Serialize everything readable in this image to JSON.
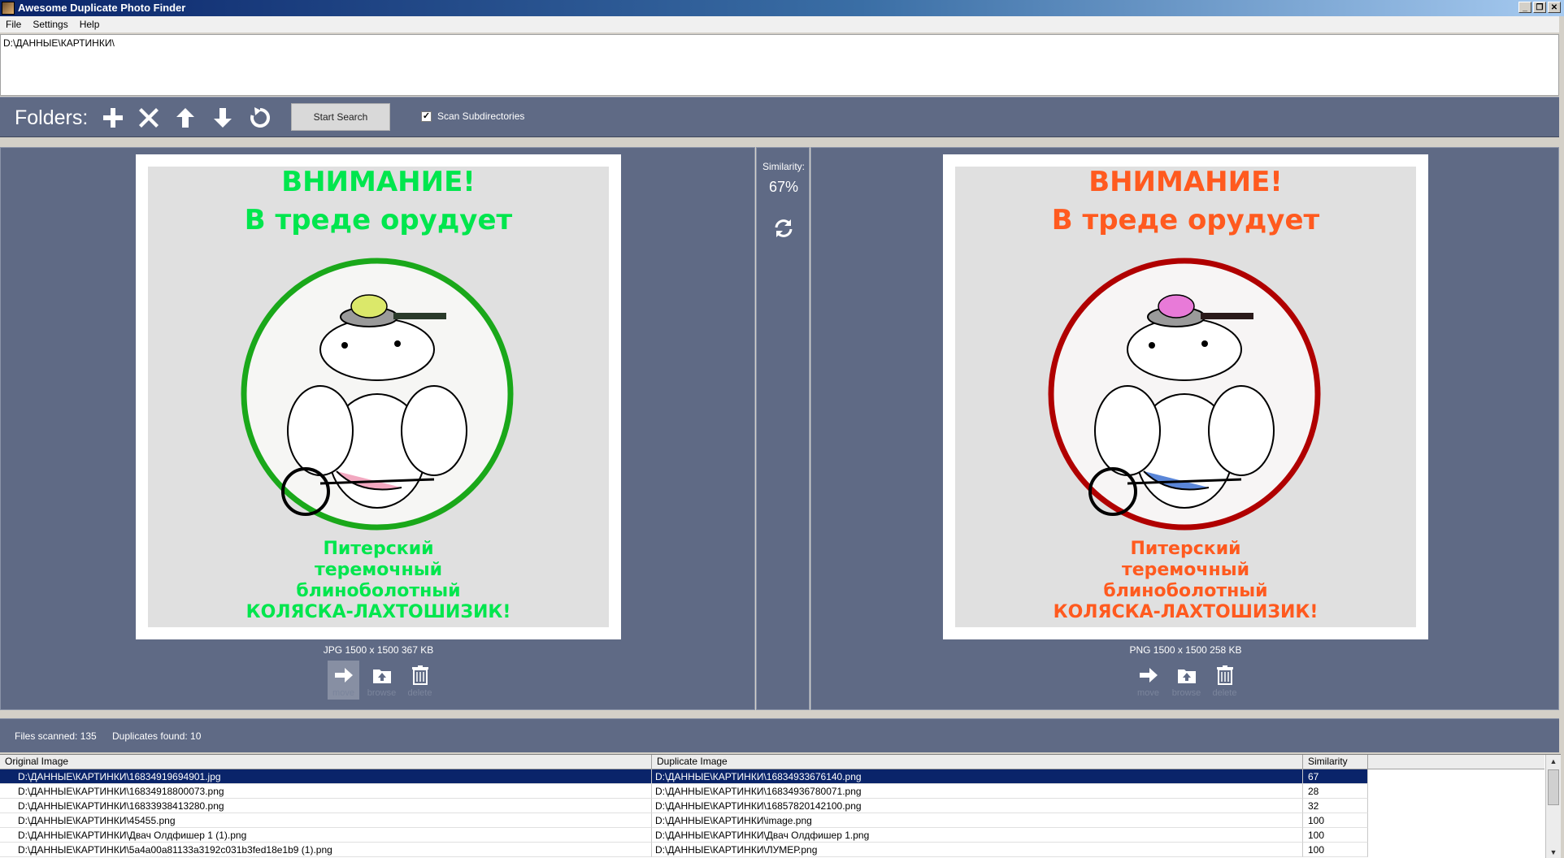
{
  "window": {
    "title": "Awesome Duplicate Photo Finder",
    "buttons": [
      "_",
      "❐",
      "✕"
    ]
  },
  "menu": [
    {
      "label": "File"
    },
    {
      "label": "Settings"
    },
    {
      "label": "Help"
    }
  ],
  "folders": {
    "paths": [
      "D:\\ДАННЫЕ\\КАРТИНКИ\\"
    ]
  },
  "toolbar": {
    "label": "Folders:",
    "icons": [
      "add-folder-icon",
      "remove-folder-icon",
      "move-up-icon",
      "move-down-icon",
      "reset-icon"
    ],
    "start_button": "Start Search",
    "scan_subdirs_label": "Scan Subdirectories",
    "scan_subdirs_checked": true
  },
  "compare": {
    "similarity_label": "Similarity:",
    "similarity_value": "67%",
    "left": {
      "info": "JPG  1500 x 1500  367 KB",
      "text_color": "#00e64d",
      "circle_color": "#1aa81a",
      "header_lines": [
        "ВНИМАНИЕ!",
        "В треде орудует"
      ],
      "footer_lines": [
        "Питерский",
        "теремочный",
        "блиноболотный",
        "КОЛЯСКА-ЛАХТОШИЗИК!"
      ],
      "actions": [
        {
          "icon": "arrow-right-icon",
          "label": "move",
          "selected": true
        },
        {
          "icon": "folder-up-icon",
          "label": "browse"
        },
        {
          "icon": "trash-icon",
          "label": "delete"
        }
      ]
    },
    "right": {
      "info": "PNG  1500 x 1500  258 KB",
      "text_color": "#ff5a1f",
      "circle_color": "#b00000",
      "header_lines": [
        "ВНИМАНИЕ!",
        "В треде орудует"
      ],
      "footer_lines": [
        "Питерский",
        "теремочный",
        "блиноболотный",
        "КОЛЯСКА-ЛАХТОШИЗИК!"
      ],
      "actions": [
        {
          "icon": "arrow-right-icon",
          "label": "move"
        },
        {
          "icon": "folder-up-icon",
          "label": "browse"
        },
        {
          "icon": "trash-icon",
          "label": "delete"
        }
      ]
    }
  },
  "status": {
    "files_scanned": "Files scanned: 135",
    "duplicates_found": "Duplicates found: 10"
  },
  "results": {
    "columns": [
      "Original Image",
      "Duplicate Image",
      "Similarity"
    ],
    "rows": [
      {
        "original": "D:\\ДАННЫЕ\\КАРТИНКИ\\16834919694901.jpg",
        "duplicate": "D:\\ДАННЫЕ\\КАРТИНКИ\\16834933676140.png",
        "similarity": "67"
      },
      {
        "original": "D:\\ДАННЫЕ\\КАРТИНКИ\\16834918800073.png",
        "duplicate": "D:\\ДАННЫЕ\\КАРТИНКИ\\16834936780071.png",
        "similarity": "28"
      },
      {
        "original": "D:\\ДАННЫЕ\\КАРТИНКИ\\16833938413280.png",
        "duplicate": "D:\\ДАННЫЕ\\КАРТИНКИ\\16857820142100.png",
        "similarity": "32"
      },
      {
        "original": "D:\\ДАННЫЕ\\КАРТИНКИ\\45455.png",
        "duplicate": "D:\\ДАННЫЕ\\КАРТИНКИ\\image.png",
        "similarity": "100"
      },
      {
        "original": "D:\\ДАННЫЕ\\КАРТИНКИ\\Двач Олдфишер 1 (1).png",
        "duplicate": "D:\\ДАННЫЕ\\КАРТИНКИ\\Двач Олдфишер 1.png",
        "similarity": "100"
      },
      {
        "original": "D:\\ДАННЫЕ\\КАРТИНКИ\\5a4a00a81133a3192c031b3fed18e1b9 (1).png",
        "duplicate": "D:\\ДАННЫЕ\\КАРТИНКИ\\ЛУМЕР.png",
        "similarity": "100"
      }
    ],
    "selected_index": 0
  }
}
